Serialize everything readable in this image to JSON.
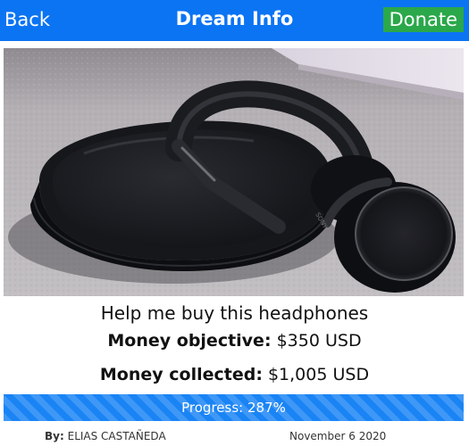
{
  "header": {
    "back_label": "Back",
    "title": "Dream Info",
    "donate_label": "Donate"
  },
  "colors": {
    "header": "#0b74f3",
    "donate_button": "#2aa84a",
    "progress_bar": "#1a84f5"
  },
  "dream": {
    "image_icon": "headphones-photo",
    "caption": "Help me buy this headphones",
    "objective_label": "Money objective:",
    "objective_value": "$350 USD",
    "collected_label": "Money collected:",
    "collected_value": "$1,005 USD"
  },
  "progress": {
    "text": "Progress: 287%",
    "percent": 287,
    "fill_fraction": 1.0
  },
  "footer": {
    "by_label": "By:",
    "author": "ELIAS CASTAÑEDA",
    "date": "November 6 2020"
  }
}
